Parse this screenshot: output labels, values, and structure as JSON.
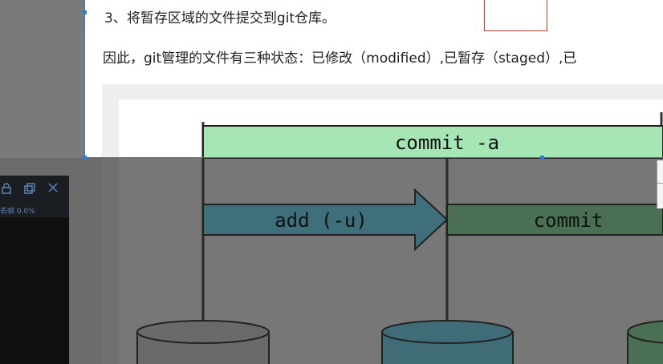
{
  "article": {
    "step3": "3、将暂存区域的文件提交到git仓库。",
    "summary": "因此，git管理的文件有三种状态：已修改（modified）,已暂存（staged）,已"
  },
  "diagram": {
    "commit_a_label": "commit -a",
    "add_label": "add (-u)",
    "commit_label": "commit"
  },
  "overlay_panel": {
    "lock_icon": "lock-icon",
    "copy_icon": "copy-icon",
    "close_icon": "close-icon",
    "stat_label": "丢帧 0.0%"
  },
  "colors": {
    "selection": "#2d7bd6",
    "commit_a_fill": "#a6e6b4",
    "add_fill": "#3f6f7a",
    "commit_fill": "#4a6f52"
  }
}
